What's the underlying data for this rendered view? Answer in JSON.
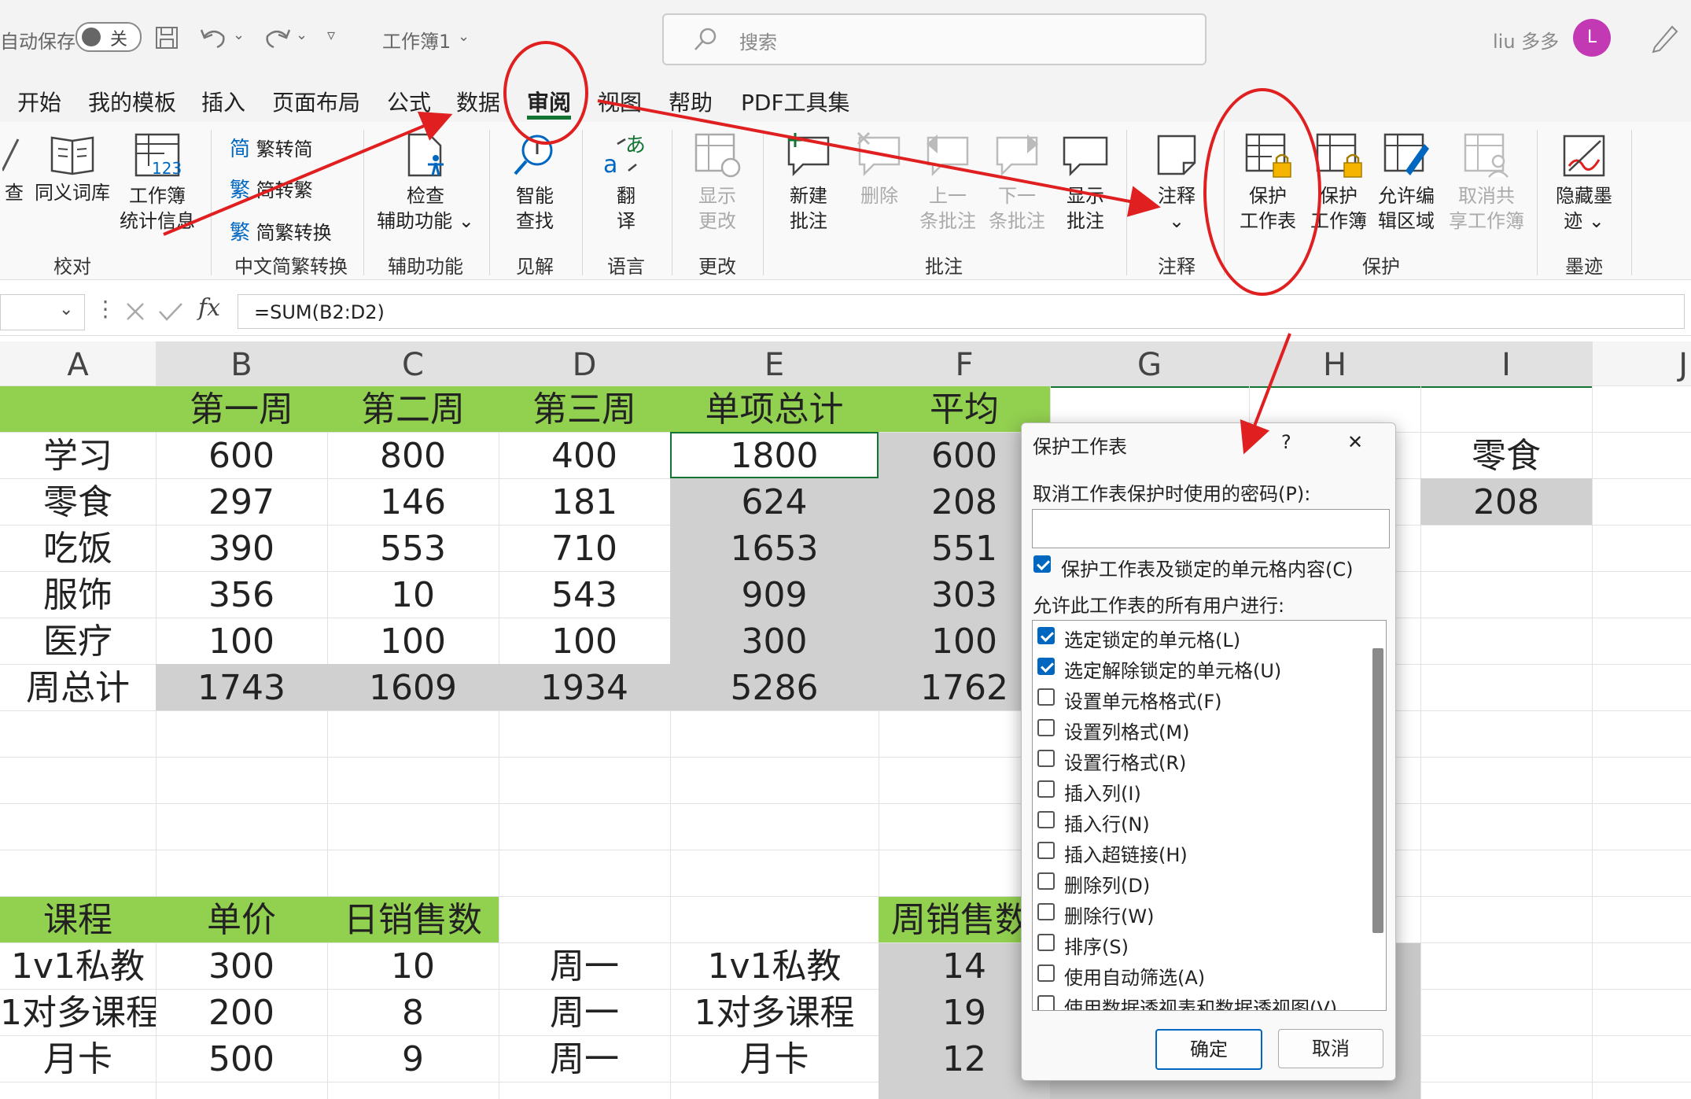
{
  "titlebar": {
    "autosave_label": "自动保存",
    "toggle_label": "关",
    "workbook_name": "工作簿1",
    "search_placeholder": "搜索",
    "user_name": "liu 多多",
    "avatar_letter": "L"
  },
  "tabs": [
    {
      "label": "开始"
    },
    {
      "label": "我的模板"
    },
    {
      "label": "插入"
    },
    {
      "label": "页面布局"
    },
    {
      "label": "公式"
    },
    {
      "label": "数据"
    },
    {
      "label": "审阅",
      "active": true
    },
    {
      "label": "视图"
    },
    {
      "label": "帮助"
    },
    {
      "label": "PDF工具集"
    }
  ],
  "ribbon": {
    "groups": {
      "proofing": "校对",
      "chinese": "中文简繁转换",
      "accessibility": "辅助功能",
      "insights": "见解",
      "language": "语言",
      "changes": "更改",
      "comments": "批注",
      "notes": "注释",
      "protect": "保护",
      "ink": "墨迹"
    },
    "buttons": {
      "check": "查",
      "thesaurus": "同义词库",
      "workbook_stats_1": "工作簿",
      "workbook_stats_2": "统计信息",
      "to_simplified": "繁转简",
      "to_traditional": "简转繁",
      "convert": "简繁转换",
      "check_access_1": "检查",
      "check_access_2": "辅助功能 ⌄",
      "smart_lookup_1": "智能",
      "smart_lookup_2": "查找",
      "translate_1": "翻",
      "translate_2": "译",
      "show_changes_1": "显示",
      "show_changes_2": "更改",
      "new_comment_1": "新建",
      "new_comment_2": "批注",
      "delete": "删除",
      "prev_comment_1": "上一",
      "prev_comment_2": "条批注",
      "next_comment_1": "下一",
      "next_comment_2": "条批注",
      "show_comments_1": "显示",
      "show_comments_2": "批注",
      "notes_1": "注释",
      "notes_2": "⌄",
      "protect_sheet_1": "保护",
      "protect_sheet_2": "工作表",
      "protect_wb_1": "保护",
      "protect_wb_2": "工作簿",
      "allow_edit_1": "允许编",
      "allow_edit_2": "辑区域",
      "unshare_1": "取消共",
      "unshare_2": "享工作簿",
      "hide_ink_1": "隐藏墨",
      "hide_ink_2": "迹 ⌄"
    }
  },
  "formula_bar": {
    "fx": "fx",
    "formula": "=SUM(B2:D2)"
  },
  "columns": [
    "A",
    "B",
    "C",
    "D",
    "E",
    "F",
    "G",
    "H",
    "I",
    "J"
  ],
  "table1": {
    "headers": [
      "",
      "第一周",
      "第二周",
      "第三周",
      "单项总计",
      "平均"
    ],
    "rows": [
      [
        "学习",
        "600",
        "800",
        "400",
        "1800",
        "600"
      ],
      [
        "零食",
        "297",
        "146",
        "181",
        "624",
        "208"
      ],
      [
        "吃饭",
        "390",
        "553",
        "710",
        "1653",
        "551"
      ],
      [
        "服饰",
        "356",
        "10",
        "543",
        "909",
        "303"
      ],
      [
        "医疗",
        "100",
        "100",
        "100",
        "300",
        "100"
      ],
      [
        "周总计",
        "1743",
        "1609",
        "1934",
        "5286",
        "1762"
      ]
    ],
    "side_label": "零食",
    "side_value": "208"
  },
  "table2": {
    "headers": [
      "课程",
      "单价",
      "日销售数"
    ],
    "week_header": "周销售数",
    "rows": [
      [
        "1v1私教",
        "300",
        "10",
        "周一",
        "1v1私教",
        "14"
      ],
      [
        "1对多课程",
        "200",
        "8",
        "周一",
        "1对多课程",
        "19"
      ],
      [
        "月卡",
        "500",
        "9",
        "周一",
        "月卡",
        "12"
      ]
    ]
  },
  "dialog": {
    "title": "保护工作表",
    "help": "?",
    "close": "✕",
    "password_label": "取消工作表保护时使用的密码(P):",
    "password_value": "",
    "protect_label": "保护工作表及锁定的单元格内容(C)",
    "protect_checked": true,
    "allow_label": "允许此工作表的所有用户进行:",
    "permissions": [
      {
        "label": "选定锁定的单元格(L)",
        "checked": true
      },
      {
        "label": "选定解除锁定的单元格(U)",
        "checked": true
      },
      {
        "label": "设置单元格格式(F)",
        "checked": false
      },
      {
        "label": "设置列格式(M)",
        "checked": false
      },
      {
        "label": "设置行格式(R)",
        "checked": false
      },
      {
        "label": "插入列(I)",
        "checked": false
      },
      {
        "label": "插入行(N)",
        "checked": false
      },
      {
        "label": "插入超链接(H)",
        "checked": false
      },
      {
        "label": "删除列(D)",
        "checked": false
      },
      {
        "label": "删除行(W)",
        "checked": false
      },
      {
        "label": "排序(S)",
        "checked": false
      },
      {
        "label": "使用自动筛选(A)",
        "checked": false
      },
      {
        "label": "使用数据透视表和数据透视图(V)",
        "checked": false
      }
    ],
    "ok": "确定",
    "cancel": "取消"
  },
  "colors": {
    "accent_green": "#92d050",
    "selection_gray": "#d0d0d0",
    "annotation_red": "#e02020",
    "checkbox_blue": "#0067c0"
  }
}
